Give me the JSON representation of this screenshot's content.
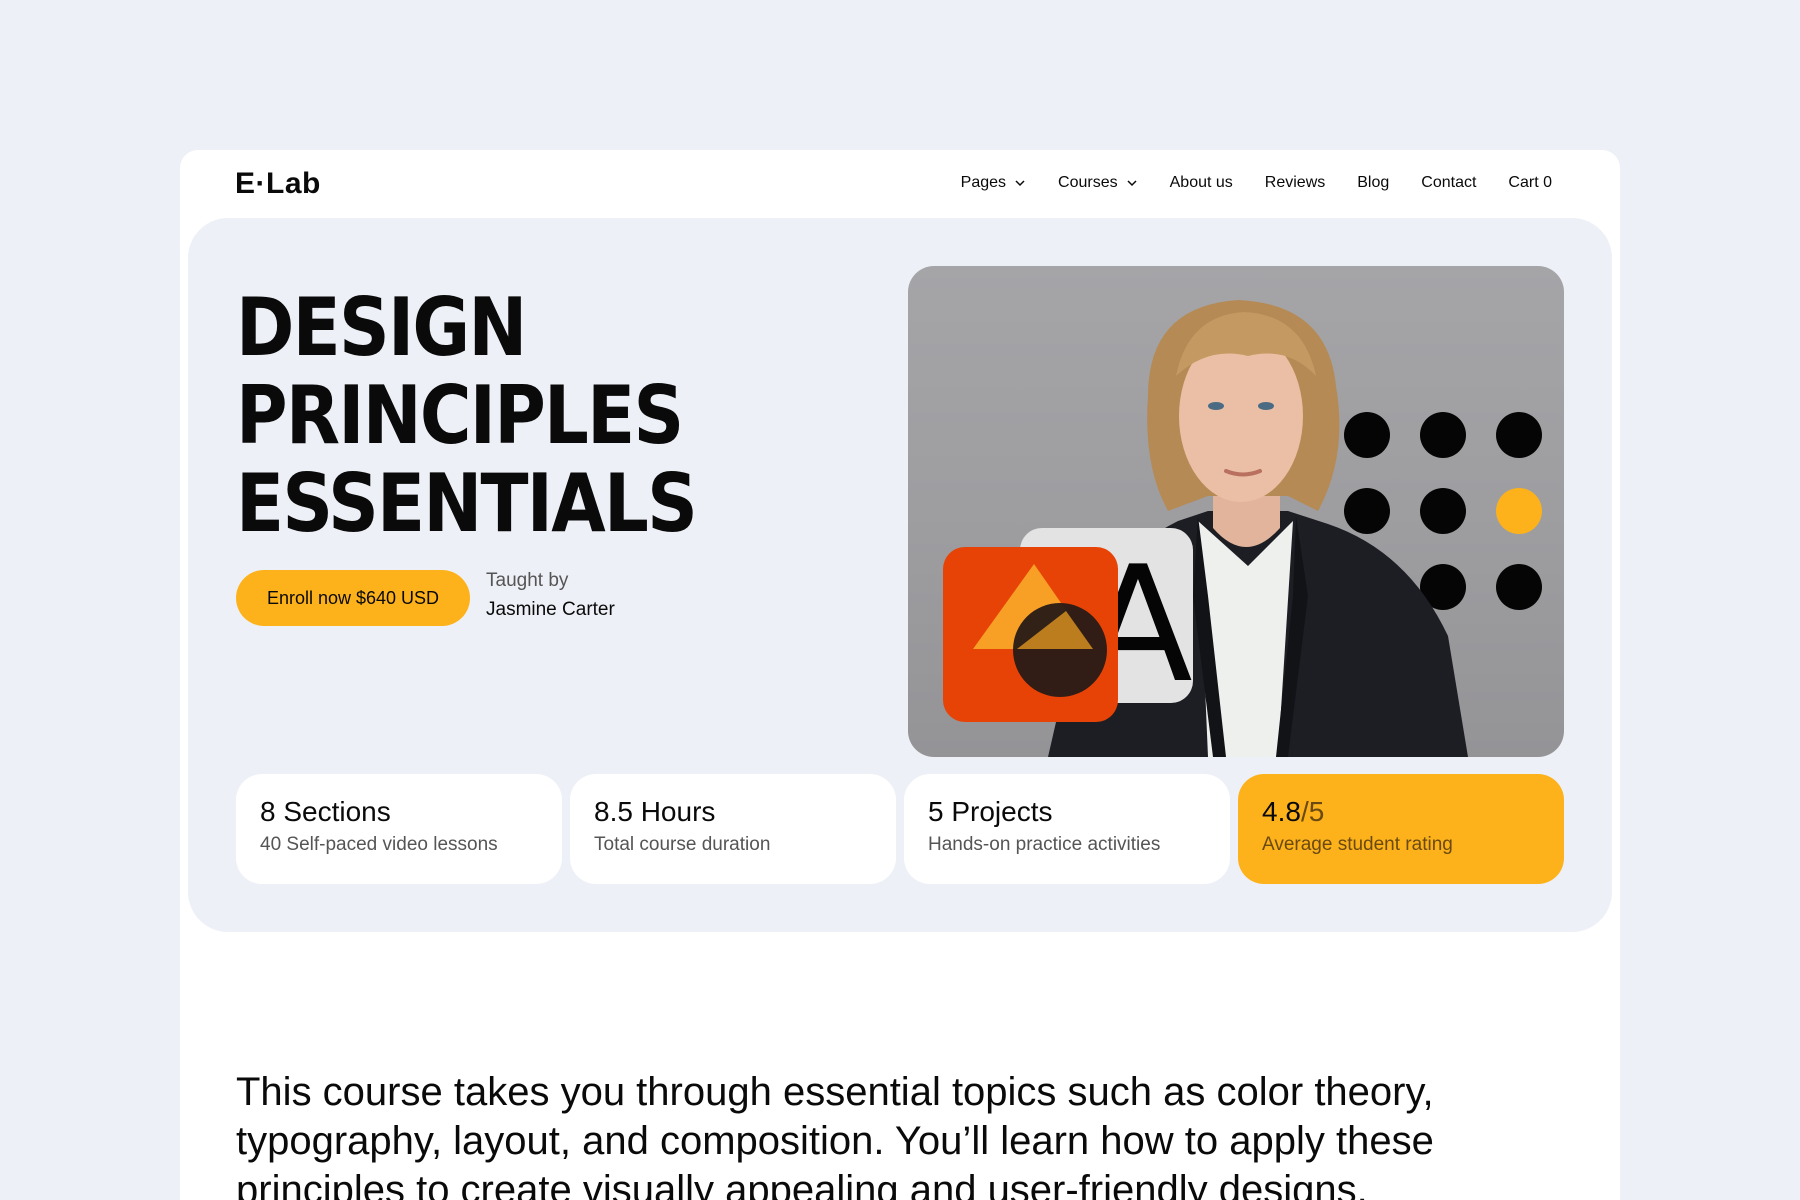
{
  "brand": {
    "logo": "E·Lab"
  },
  "nav": {
    "items": [
      {
        "label": "Pages",
        "dropdown": true
      },
      {
        "label": "Courses",
        "dropdown": true
      },
      {
        "label": "About us"
      },
      {
        "label": "Reviews"
      },
      {
        "label": "Blog"
      },
      {
        "label": "Contact"
      },
      {
        "label": "Cart 0"
      }
    ]
  },
  "hero": {
    "title_lines": [
      "DESIGN",
      "PRINCIPLES",
      "ESSENTIALS"
    ],
    "enroll_label": "Enroll now $640 USD",
    "taught_by_label": "Taught by",
    "instructor": "Jasmine Carter",
    "image_letter": "A"
  },
  "stats": [
    {
      "title": "8 Sections",
      "subtitle": "40 Self-paced video lessons"
    },
    {
      "title": "8.5 Hours",
      "subtitle": "Total course duration"
    },
    {
      "title": "5 Projects",
      "subtitle": "Hands-on practice activities"
    },
    {
      "title_value": "4.8",
      "title_of": "/5",
      "subtitle": "Average student rating"
    }
  ],
  "description": "This course takes you through essential topics such as color theory, typography, layout, and composition. You’ll learn how to apply these principles to create visually appealing and user-friendly designs.",
  "colors": {
    "accent": "#fdb21b",
    "orange_tile": "#e84306",
    "background": "#edf0f6"
  }
}
